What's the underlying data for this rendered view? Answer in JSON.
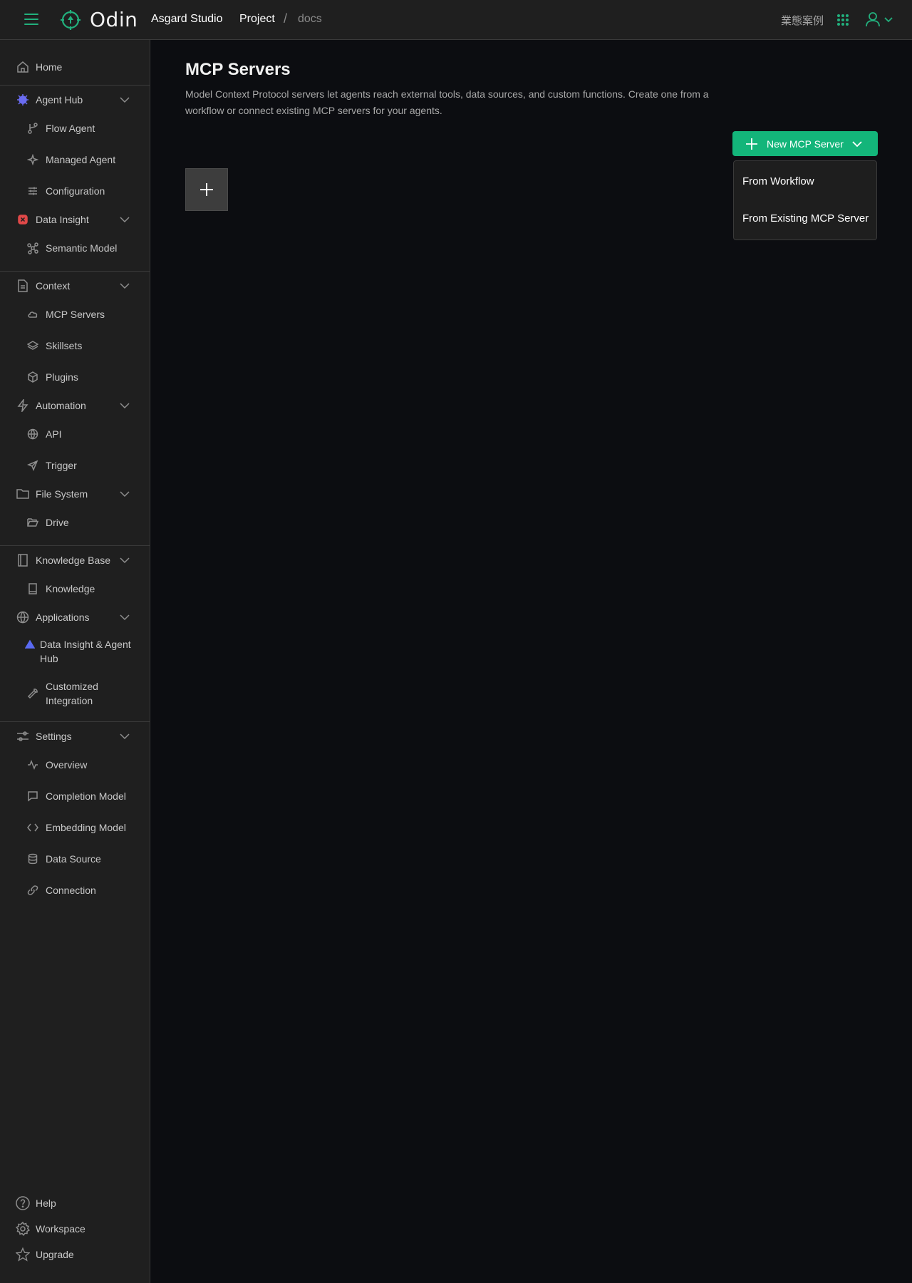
{
  "topbar": {
    "brand": "Odin",
    "studio": "Asgard Studio",
    "breadcrumb": [
      "Project",
      "/",
      "docs"
    ],
    "cases_link": "業態案例"
  },
  "sidebar": {
    "home": "Home",
    "agent_hub": "Agent Hub",
    "flow_agent": "Flow Agent",
    "managed_agent": "Managed Agent",
    "configuration": "Configuration",
    "data_insight": "Data Insight",
    "semantic_model": "Semantic Model",
    "context": "Context",
    "mcp_servers": "MCP Servers",
    "skillsets": "Skillsets",
    "plugins": "Plugins",
    "automation": "Automation",
    "api": "API",
    "trigger": "Trigger",
    "file_system": "File System",
    "drive": "Drive",
    "knowledge_base": "Knowledge Base",
    "knowledge": "Knowledge",
    "applications": "Applications",
    "data_insight_agent_hub": "Data Insight & Agent Hub",
    "customized_integration": "Customized Integration",
    "settings": "Settings",
    "overview": "Overview",
    "completion_model": "Completion Model",
    "embedding_model": "Embedding Model",
    "data_source": "Data Source",
    "connection": "Connection",
    "help": "Help",
    "workspace": "Workspace",
    "upgrade": "Upgrade"
  },
  "main": {
    "title": "MCP Servers",
    "description": "Model Context Protocol servers let agents reach external tools, data sources, and custom functions. Create one from a workflow or connect existing MCP servers for your agents.",
    "new_button": "New MCP Server",
    "dropdown": [
      "From Workflow",
      "From Existing MCP Server"
    ]
  },
  "colors": {
    "accent": "#13b57a",
    "background": "#0c0d11",
    "panel": "#1f1f1f"
  }
}
